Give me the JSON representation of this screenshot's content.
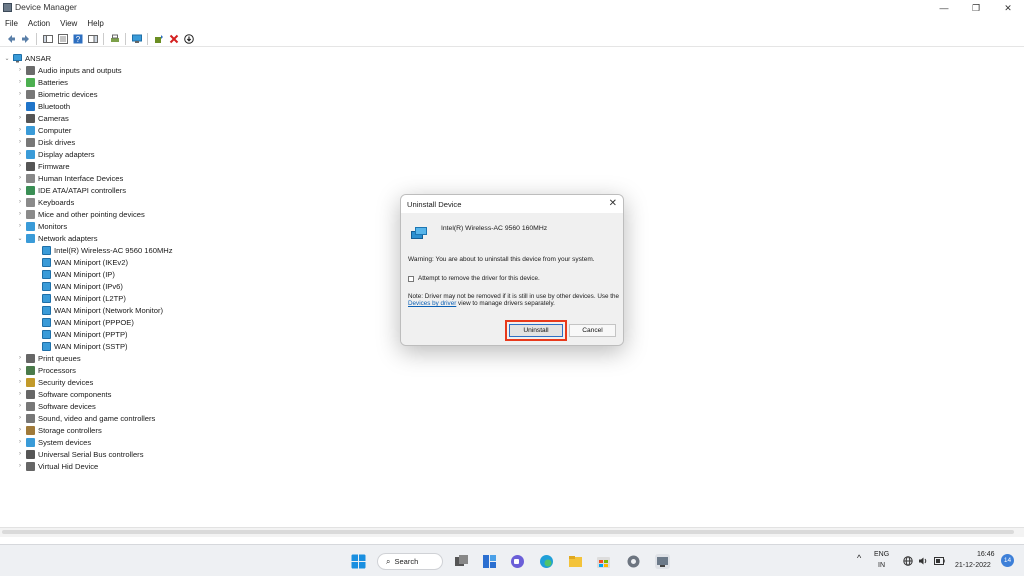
{
  "window": {
    "title": "Device Manager",
    "controls": [
      "—",
      "❐",
      "✕"
    ]
  },
  "menu": [
    "File",
    "Action",
    "View",
    "Help"
  ],
  "tree": {
    "root": "ANSAR",
    "categories": [
      {
        "label": "Audio inputs and outputs",
        "icon": "speaker-icon",
        "color": "#6b6b6b"
      },
      {
        "label": "Batteries",
        "icon": "battery-icon",
        "color": "#4caf50"
      },
      {
        "label": "Biometric devices",
        "icon": "fingerprint-icon",
        "color": "#777777"
      },
      {
        "label": "Bluetooth",
        "icon": "bluetooth-icon",
        "color": "#1f74c9"
      },
      {
        "label": "Cameras",
        "icon": "camera-icon",
        "color": "#555555"
      },
      {
        "label": "Computer",
        "icon": "computer-icon",
        "color": "#3a9bd8"
      },
      {
        "label": "Disk drives",
        "icon": "disk-icon",
        "color": "#777777"
      },
      {
        "label": "Display adapters",
        "icon": "display-icon",
        "color": "#3a9bd8"
      },
      {
        "label": "Firmware",
        "icon": "firmware-icon",
        "color": "#555555"
      },
      {
        "label": "Human Interface Devices",
        "icon": "hid-icon",
        "color": "#888888"
      },
      {
        "label": "IDE ATA/ATAPI controllers",
        "icon": "ide-icon",
        "color": "#3a8f55"
      },
      {
        "label": "Keyboards",
        "icon": "keyboard-icon",
        "color": "#8a8a8a"
      },
      {
        "label": "Mice and other pointing devices",
        "icon": "mouse-icon",
        "color": "#8a8a8a"
      },
      {
        "label": "Monitors",
        "icon": "monitor-icon",
        "color": "#3a9bd8"
      },
      {
        "label": "Network adapters",
        "icon": "network-icon",
        "color": "#3a9bd8",
        "expanded": true,
        "children": [
          "Intel(R) Wireless-AC 9560 160MHz",
          "WAN Miniport (IKEv2)",
          "WAN Miniport (IP)",
          "WAN Miniport (IPv6)",
          "WAN Miniport (L2TP)",
          "WAN Miniport (Network Monitor)",
          "WAN Miniport (PPPOE)",
          "WAN Miniport (PPTP)",
          "WAN Miniport (SSTP)"
        ]
      },
      {
        "label": "Print queues",
        "icon": "printer-icon",
        "color": "#666666"
      },
      {
        "label": "Processors",
        "icon": "processor-icon",
        "color": "#4a7a4a"
      },
      {
        "label": "Security devices",
        "icon": "security-icon",
        "color": "#c29a2a"
      },
      {
        "label": "Software components",
        "icon": "software-component-icon",
        "color": "#666666"
      },
      {
        "label": "Software devices",
        "icon": "software-device-icon",
        "color": "#777777"
      },
      {
        "label": "Sound, video and game controllers",
        "icon": "sound-icon",
        "color": "#777777"
      },
      {
        "label": "Storage controllers",
        "icon": "storage-icon",
        "color": "#a07a3a"
      },
      {
        "label": "System devices",
        "icon": "system-icon",
        "color": "#3a9bd8"
      },
      {
        "label": "Universal Serial Bus controllers",
        "icon": "usb-icon",
        "color": "#555555"
      },
      {
        "label": "Virtual Hid Device",
        "icon": "virtual-hid-icon",
        "color": "#666666"
      }
    ]
  },
  "dialog": {
    "title": "Uninstall Device",
    "device_name": "Intel(R) Wireless-AC 9560 160MHz",
    "warning": "Warning: You are about to uninstall this device from your system.",
    "checkbox_label": "Attempt to remove the driver for this device.",
    "note_pre": "Note: Driver may not be removed if it is still in use by other devices. Use the ",
    "note_link": "Devices by driver",
    "note_post": " view to manage drivers separately.",
    "uninstall_label": "Uninstall",
    "cancel_label": "Cancel",
    "highlight_color": "#e8391b"
  },
  "taskbar": {
    "search_label": "Search",
    "lang_top": "ENG",
    "lang_bottom": "IN",
    "time": "16:46",
    "date": "21-12-2022",
    "notification_count": "14"
  }
}
